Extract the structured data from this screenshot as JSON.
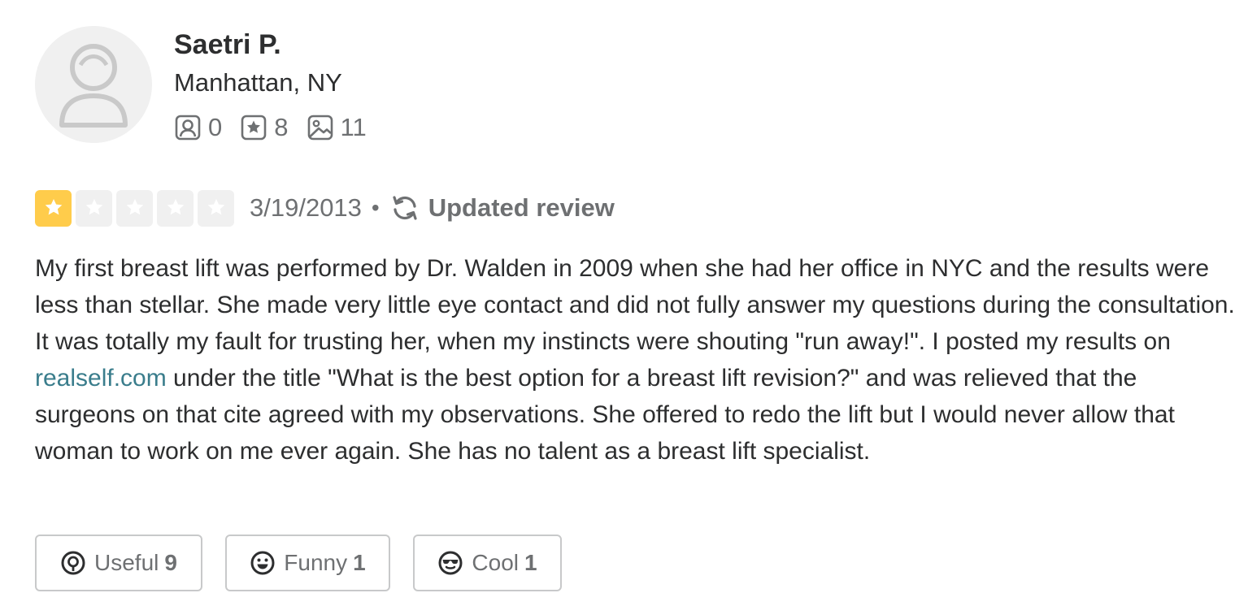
{
  "user": {
    "name": "Saetri P.",
    "location": "Manhattan, NY",
    "stats": {
      "friends": "0",
      "reviews": "8",
      "photos": "11"
    }
  },
  "review": {
    "rating": 1,
    "rating_max": 5,
    "date": "3/19/2013",
    "separator": "•",
    "updated_label": "Updated review",
    "text_part1": "My first breast lift was performed by Dr. Walden in 2009 when she had her office in NYC and the results were less than stellar. She made very little eye contact and did not fully answer my questions during the consultation. It was totally my fault for trusting her, when my instincts were shouting \"run away!\". I posted my results on ",
    "link_text": "realself.com",
    "text_part2": " under the title \"What is the best option for a breast lift revision?\" and was relieved that the surgeons on that cite agreed with my observations. She offered to redo the lift but I would never allow that woman to work on me ever again. She has no talent as a breast lift specialist."
  },
  "reactions": {
    "useful": {
      "label": "Useful",
      "count": "9"
    },
    "funny": {
      "label": "Funny",
      "count": "1"
    },
    "cool": {
      "label": "Cool",
      "count": "1"
    }
  },
  "colors": {
    "star_filled": "#ffcc4b",
    "star_empty": "#f0f0f0",
    "link": "#3a7d8c",
    "muted_text": "#6e7072"
  },
  "icons": {
    "avatar": "default-user-avatar-icon",
    "friends": "friends-icon",
    "reviews": "review-star-icon",
    "photos": "photo-icon",
    "updated": "refresh-icon",
    "useful": "lightbulb-icon",
    "funny": "smile-icon",
    "cool": "sunglasses-icon"
  }
}
